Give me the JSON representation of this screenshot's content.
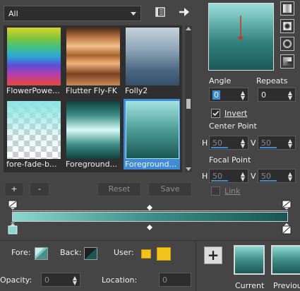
{
  "category_select": {
    "value": "All"
  },
  "tiles": [
    {
      "name": "FlowerPowe..."
    },
    {
      "name": "Flutter Fly-FK"
    },
    {
      "name": "Folly2"
    },
    {
      "name": "fore-fade-b..."
    },
    {
      "name": "Foreground..."
    },
    {
      "name": "Foreground..."
    }
  ],
  "grid_buttons": {
    "add": "+",
    "remove": "-",
    "reset": "Reset",
    "save": "Save"
  },
  "angle": {
    "label": "Angle",
    "value": "0"
  },
  "repeats": {
    "label": "Repeats",
    "value": "0"
  },
  "invert": {
    "label": "Invert",
    "checked": true
  },
  "center_point": {
    "label": "Center Point",
    "h_label": "H",
    "h": "50",
    "v_label": "V",
    "v": "50"
  },
  "focal_point": {
    "label": "Focal Point",
    "h_label": "H",
    "h": "50",
    "v_label": "V",
    "v": "50"
  },
  "link": {
    "label": "Link",
    "checked": false
  },
  "bottom": {
    "fore_label": "Fore:",
    "back_label": "Back:",
    "user_label": "User:",
    "opacity_label": "Opacity:",
    "opacity_value": "0",
    "location_label": "Location:",
    "location_value": "0",
    "add_label": "+",
    "current_label": "Current",
    "previous_label": "Previous"
  },
  "colors": {
    "accent": "#3f8bd6",
    "user_swatch": "#f2c31b",
    "gradient_start": "#8ad7d0",
    "gradient_end": "#155652"
  }
}
